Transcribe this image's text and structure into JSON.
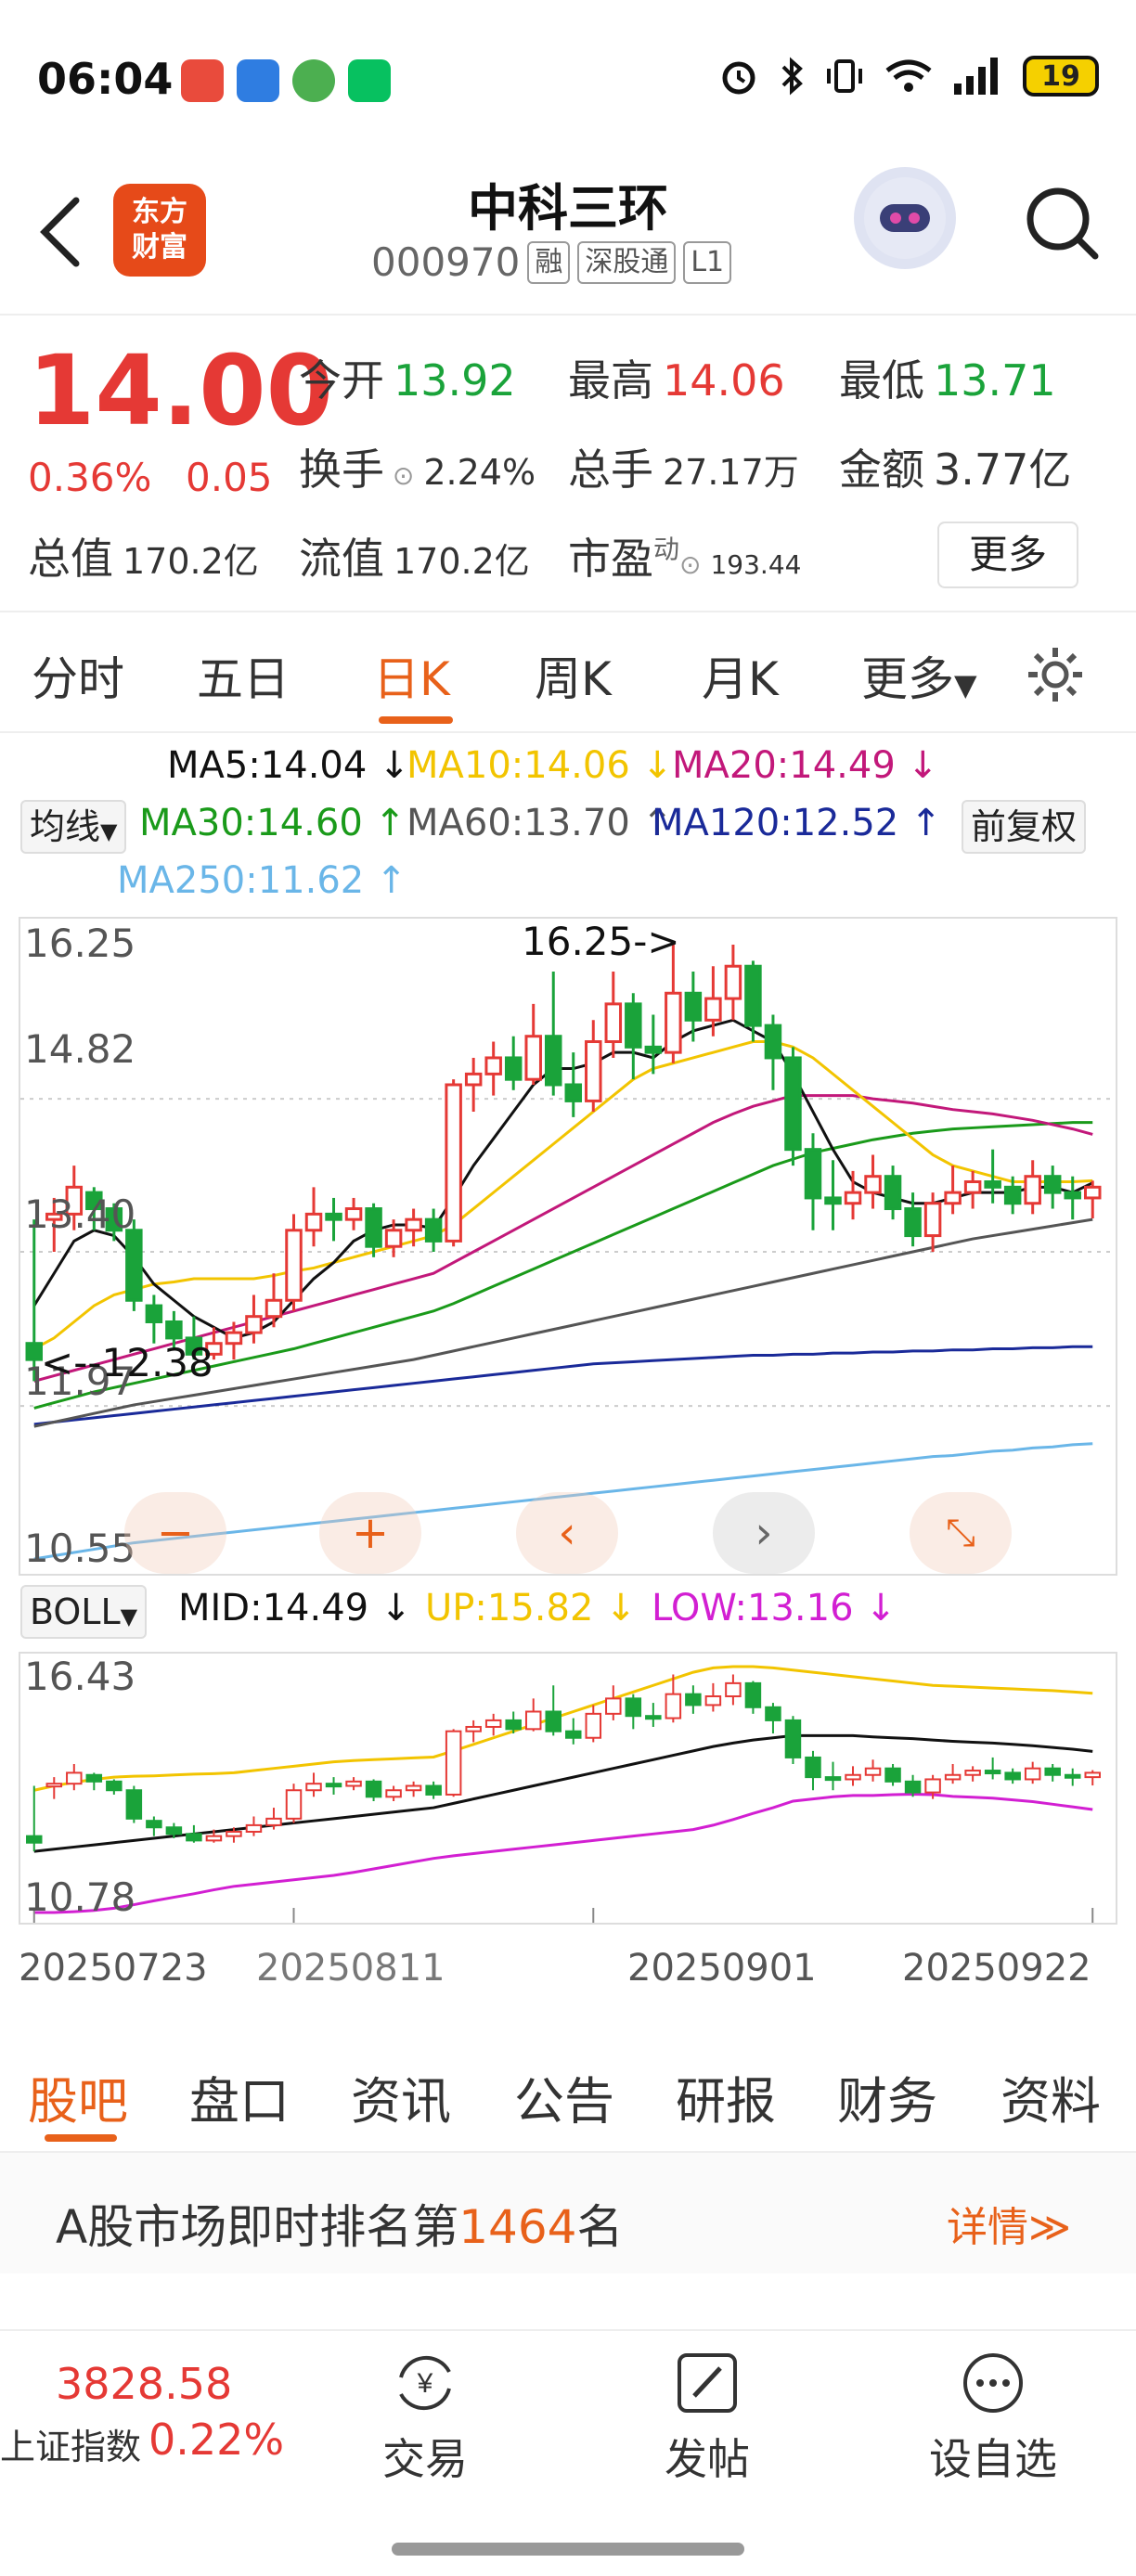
{
  "status": {
    "time": "06:04",
    "battery": "19"
  },
  "header": {
    "logo_text_1": "东方",
    "logo_text_2": "财富",
    "name": "中科三环",
    "code": "000970",
    "tags": [
      "融",
      "深股通",
      "L1"
    ]
  },
  "quote": {
    "price": "14.00",
    "pct": "0.36%",
    "change": "0.05",
    "open_label": "今开",
    "open": "13.92",
    "high_label": "最高",
    "high": "14.06",
    "low_label": "最低",
    "low": "13.71",
    "turnover_label": "换手",
    "turnover": "2.24%",
    "volume_label": "总手",
    "volume": "27.17万",
    "amount_label": "金额",
    "amount": "3.77亿",
    "mktcap_label": "总值",
    "mktcap": "170.2亿",
    "float_label": "流值",
    "float": "170.2亿",
    "pe_label": "市盈",
    "pe_sup": "动",
    "pe": "193.44",
    "more": "更多"
  },
  "period_tabs": [
    "分时",
    "五日",
    "日K",
    "周K",
    "月K",
    "更多"
  ],
  "ma_legend": {
    "ma5": "MA5:14.04 ↓",
    "ma10": "MA10:14.06 ↓",
    "ma20": "MA20:14.49 ↓",
    "indicator_select": "均线",
    "ma30": "MA30:14.60 ↑",
    "ma60": "MA60:13.70 ↑",
    "ma120": "MA120:12.52 ↑",
    "adjust": "前复权",
    "ma250": "MA250:11.62 ↑"
  },
  "colors": {
    "up": "#e53935",
    "down": "#1aa33a",
    "accent": "#e8611a",
    "ma5": "#111111",
    "ma10": "#f2c400",
    "ma20": "#c2187a",
    "ma30": "#1a9a1a",
    "ma60": "#555555",
    "ma120": "#1a2a99",
    "ma250": "#6ab6e8"
  },
  "kchart_labels": {
    "y_top": "16.25",
    "y_2": "14.82",
    "y_3": "13.40",
    "y_4": "11.97",
    "y_bottom": "10.55",
    "high_mark": "16.25->",
    "low_mark": "<--12.38"
  },
  "boll": {
    "select": "BOLL",
    "mid": "MID:14.49 ↓",
    "up": "UP:15.82 ↓",
    "low": "LOW:13.16 ↓",
    "y_top": "16.43",
    "y_bottom": "10.78"
  },
  "dates": [
    "20250723",
    "20250811",
    "20250901",
    "20250922"
  ],
  "chart_data": {
    "type": "candlestick",
    "ylim": [
      10.55,
      16.25
    ],
    "candles": [
      [
        12.55,
        12.4,
        13.7,
        12.2
      ],
      [
        13.7,
        13.75,
        13.9,
        13.4
      ],
      [
        13.75,
        14.0,
        14.2,
        13.6
      ],
      [
        13.95,
        13.8,
        14.0,
        13.6
      ],
      [
        13.8,
        13.6,
        13.85,
        13.5
      ],
      [
        13.6,
        12.95,
        13.7,
        12.85
      ],
      [
        12.9,
        12.75,
        13.0,
        12.55
      ],
      [
        12.75,
        12.6,
        12.85,
        12.5
      ],
      [
        12.6,
        12.45,
        12.8,
        12.4
      ],
      [
        12.45,
        12.55,
        12.7,
        12.4
      ],
      [
        12.55,
        12.65,
        12.75,
        12.4
      ],
      [
        12.65,
        12.8,
        13.0,
        12.55
      ],
      [
        12.8,
        12.95,
        13.2,
        12.7
      ],
      [
        12.95,
        13.6,
        13.75,
        12.85
      ],
      [
        13.6,
        13.75,
        14.0,
        13.45
      ],
      [
        13.75,
        13.7,
        13.9,
        13.5
      ],
      [
        13.7,
        13.8,
        13.9,
        13.6
      ],
      [
        13.8,
        13.45,
        13.85,
        13.35
      ],
      [
        13.45,
        13.6,
        13.7,
        13.35
      ],
      [
        13.6,
        13.7,
        13.8,
        13.45
      ],
      [
        13.7,
        13.5,
        13.8,
        13.4
      ],
      [
        13.5,
        14.95,
        15.0,
        13.45
      ],
      [
        14.95,
        15.05,
        15.2,
        14.7
      ],
      [
        15.05,
        15.2,
        15.35,
        14.85
      ],
      [
        15.2,
        15.0,
        15.4,
        14.9
      ],
      [
        15.0,
        15.4,
        15.7,
        14.95
      ],
      [
        15.4,
        14.95,
        16.0,
        14.85
      ],
      [
        14.95,
        14.8,
        15.25,
        14.65
      ],
      [
        14.8,
        15.35,
        15.55,
        14.7
      ],
      [
        15.35,
        15.7,
        16.0,
        15.2
      ],
      [
        15.7,
        15.3,
        15.8,
        15.0
      ],
      [
        15.3,
        15.25,
        15.6,
        15.05
      ],
      [
        15.25,
        15.8,
        16.25,
        15.15
      ],
      [
        15.8,
        15.55,
        16.0,
        15.35
      ],
      [
        15.55,
        15.75,
        16.05,
        15.4
      ],
      [
        15.75,
        16.05,
        16.25,
        15.55
      ],
      [
        16.05,
        15.5,
        16.1,
        15.35
      ],
      [
        15.5,
        15.2,
        15.6,
        14.9
      ],
      [
        15.2,
        14.35,
        15.3,
        14.2
      ],
      [
        14.35,
        13.9,
        14.5,
        13.6
      ],
      [
        13.9,
        13.85,
        14.25,
        13.6
      ],
      [
        13.85,
        13.95,
        14.15,
        13.7
      ],
      [
        13.95,
        14.1,
        14.3,
        13.8
      ],
      [
        14.1,
        13.8,
        14.2,
        13.7
      ],
      [
        13.8,
        13.55,
        13.95,
        13.45
      ],
      [
        13.55,
        13.85,
        13.95,
        13.4
      ],
      [
        13.85,
        13.95,
        14.2,
        13.75
      ],
      [
        13.95,
        14.05,
        14.15,
        13.8
      ],
      [
        14.05,
        14.0,
        14.35,
        13.85
      ],
      [
        14.0,
        13.85,
        14.1,
        13.75
      ],
      [
        13.85,
        14.1,
        14.25,
        13.75
      ],
      [
        14.1,
        13.95,
        14.2,
        13.8
      ],
      [
        13.95,
        13.9,
        14.1,
        13.7
      ],
      [
        13.9,
        14.0,
        14.06,
        13.71
      ]
    ],
    "ma5": [
      12.9,
      13.2,
      13.5,
      13.6,
      13.55,
      13.35,
      13.1,
      12.95,
      12.8,
      12.7,
      12.6,
      12.65,
      12.75,
      12.95,
      13.15,
      13.3,
      13.5,
      13.6,
      13.65,
      13.65,
      13.62,
      13.9,
      14.2,
      14.45,
      14.7,
      14.95,
      15.1,
      15.1,
      15.15,
      15.25,
      15.25,
      15.2,
      15.35,
      15.45,
      15.5,
      15.55,
      15.45,
      15.35,
      15.05,
      14.7,
      14.35,
      14.05,
      13.95,
      13.9,
      13.85,
      13.85,
      13.9,
      13.95,
      13.95,
      13.95,
      14.0,
      14.0,
      13.95,
      14.04
    ],
    "ma10": [
      12.5,
      12.6,
      12.75,
      12.9,
      13.0,
      13.05,
      13.1,
      13.12,
      13.15,
      13.15,
      13.15,
      13.15,
      13.18,
      13.22,
      13.25,
      13.3,
      13.35,
      13.4,
      13.45,
      13.5,
      13.55,
      13.65,
      13.8,
      13.95,
      14.1,
      14.25,
      14.4,
      14.55,
      14.7,
      14.85,
      15.0,
      15.1,
      15.15,
      15.2,
      15.25,
      15.3,
      15.35,
      15.35,
      15.3,
      15.2,
      15.05,
      14.9,
      14.75,
      14.6,
      14.45,
      14.3,
      14.2,
      14.15,
      14.1,
      14.05,
      14.05,
      14.05,
      14.05,
      14.06
    ],
    "ma20": [
      12.2,
      12.25,
      12.3,
      12.35,
      12.4,
      12.45,
      12.5,
      12.55,
      12.6,
      12.65,
      12.7,
      12.75,
      12.8,
      12.85,
      12.9,
      12.95,
      13.0,
      13.05,
      13.1,
      13.15,
      13.2,
      13.3,
      13.4,
      13.5,
      13.6,
      13.7,
      13.8,
      13.9,
      14.0,
      14.1,
      14.2,
      14.3,
      14.4,
      14.5,
      14.6,
      14.68,
      14.75,
      14.8,
      14.85,
      14.85,
      14.85,
      14.85,
      14.82,
      14.8,
      14.78,
      14.75,
      14.72,
      14.7,
      14.68,
      14.65,
      14.62,
      14.58,
      14.54,
      14.49
    ],
    "ma30": [
      11.95,
      12.0,
      12.05,
      12.1,
      12.14,
      12.18,
      12.22,
      12.26,
      12.3,
      12.34,
      12.38,
      12.42,
      12.46,
      12.5,
      12.55,
      12.6,
      12.65,
      12.7,
      12.75,
      12.8,
      12.85,
      12.92,
      13.0,
      13.08,
      13.16,
      13.24,
      13.32,
      13.4,
      13.48,
      13.56,
      13.64,
      13.72,
      13.8,
      13.88,
      13.96,
      14.04,
      14.12,
      14.2,
      14.26,
      14.32,
      14.36,
      14.4,
      14.44,
      14.47,
      14.5,
      14.52,
      14.54,
      14.55,
      14.56,
      14.57,
      14.58,
      14.59,
      14.6,
      14.6
    ],
    "ma60": [
      11.78,
      11.82,
      11.86,
      11.9,
      11.94,
      11.98,
      12.01,
      12.04,
      12.07,
      12.1,
      12.13,
      12.16,
      12.19,
      12.22,
      12.25,
      12.28,
      12.31,
      12.34,
      12.37,
      12.4,
      12.44,
      12.48,
      12.52,
      12.56,
      12.6,
      12.64,
      12.68,
      12.72,
      12.76,
      12.8,
      12.84,
      12.88,
      12.92,
      12.96,
      13.0,
      13.04,
      13.08,
      13.12,
      13.16,
      13.2,
      13.24,
      13.28,
      13.32,
      13.36,
      13.4,
      13.44,
      13.48,
      13.52,
      13.55,
      13.58,
      13.61,
      13.64,
      13.67,
      13.7
    ],
    "ma120": [
      11.8,
      11.82,
      11.84,
      11.86,
      11.88,
      11.9,
      11.92,
      11.94,
      11.96,
      11.98,
      12.0,
      12.02,
      12.04,
      12.06,
      12.08,
      12.1,
      12.12,
      12.14,
      12.16,
      12.18,
      12.2,
      12.22,
      12.24,
      12.26,
      12.28,
      12.3,
      12.32,
      12.34,
      12.36,
      12.37,
      12.38,
      12.39,
      12.4,
      12.41,
      12.42,
      12.43,
      12.44,
      12.44,
      12.45,
      12.45,
      12.46,
      12.46,
      12.47,
      12.47,
      12.48,
      12.48,
      12.49,
      12.49,
      12.5,
      12.5,
      12.51,
      12.51,
      12.52,
      12.52
    ],
    "ma250": [
      10.55,
      10.58,
      10.61,
      10.64,
      10.67,
      10.7,
      10.72,
      10.74,
      10.76,
      10.78,
      10.8,
      10.82,
      10.84,
      10.86,
      10.88,
      10.9,
      10.92,
      10.94,
      10.96,
      10.98,
      11.0,
      11.02,
      11.04,
      11.06,
      11.08,
      11.1,
      11.12,
      11.14,
      11.16,
      11.18,
      11.2,
      11.22,
      11.24,
      11.26,
      11.28,
      11.3,
      11.32,
      11.34,
      11.36,
      11.38,
      11.4,
      11.42,
      11.44,
      11.46,
      11.48,
      11.5,
      11.51,
      11.53,
      11.55,
      11.56,
      11.58,
      11.59,
      11.61,
      11.62
    ],
    "boll_ylim": [
      10.78,
      16.43
    ],
    "boll_up": [
      13.6,
      13.7,
      13.78,
      13.85,
      13.9,
      13.92,
      13.93,
      13.95,
      13.97,
      13.98,
      14.0,
      14.05,
      14.1,
      14.15,
      14.2,
      14.25,
      14.28,
      14.3,
      14.32,
      14.34,
      14.36,
      14.5,
      14.65,
      14.8,
      14.95,
      15.1,
      15.25,
      15.4,
      15.55,
      15.7,
      15.85,
      16.0,
      16.15,
      16.3,
      16.4,
      16.43,
      16.43,
      16.4,
      16.35,
      16.3,
      16.25,
      16.2,
      16.15,
      16.1,
      16.05,
      16.0,
      15.98,
      15.96,
      15.94,
      15.92,
      15.9,
      15.88,
      15.85,
      15.82
    ],
    "boll_mid": [
      12.2,
      12.25,
      12.3,
      12.35,
      12.4,
      12.45,
      12.5,
      12.55,
      12.6,
      12.65,
      12.7,
      12.75,
      12.8,
      12.85,
      12.9,
      12.95,
      13.0,
      13.05,
      13.1,
      13.15,
      13.2,
      13.3,
      13.4,
      13.5,
      13.6,
      13.7,
      13.8,
      13.9,
      14.0,
      14.1,
      14.2,
      14.3,
      14.4,
      14.5,
      14.6,
      14.68,
      14.75,
      14.8,
      14.85,
      14.85,
      14.85,
      14.85,
      14.82,
      14.8,
      14.78,
      14.75,
      14.72,
      14.7,
      14.68,
      14.65,
      14.62,
      14.58,
      14.54,
      14.49
    ],
    "boll_low": [
      10.8,
      10.8,
      10.82,
      10.85,
      10.9,
      10.98,
      11.07,
      11.15,
      11.23,
      11.32,
      11.4,
      11.45,
      11.5,
      11.55,
      11.6,
      11.65,
      11.72,
      11.8,
      11.88,
      11.96,
      12.04,
      12.1,
      12.15,
      12.2,
      12.25,
      12.3,
      12.35,
      12.4,
      12.45,
      12.5,
      12.55,
      12.6,
      12.65,
      12.7,
      12.8,
      12.93,
      13.07,
      13.2,
      13.35,
      13.4,
      13.45,
      13.48,
      13.48,
      13.5,
      13.51,
      13.5,
      13.46,
      13.44,
      13.42,
      13.38,
      13.34,
      13.28,
      13.22,
      13.16
    ]
  },
  "sub_tabs": [
    "股吧",
    "盘口",
    "资讯",
    "公告",
    "研报",
    "财务",
    "资料"
  ],
  "rank": {
    "prefix": "A股市场即时排名第",
    "num": "1464",
    "suffix": "名",
    "detail": "详情≫"
  },
  "bottom": {
    "index_value": "3828.58",
    "index_name": "上证指数",
    "index_pct": "0.22%",
    "trade": "交易",
    "post": "发帖",
    "fav": "设自选"
  }
}
